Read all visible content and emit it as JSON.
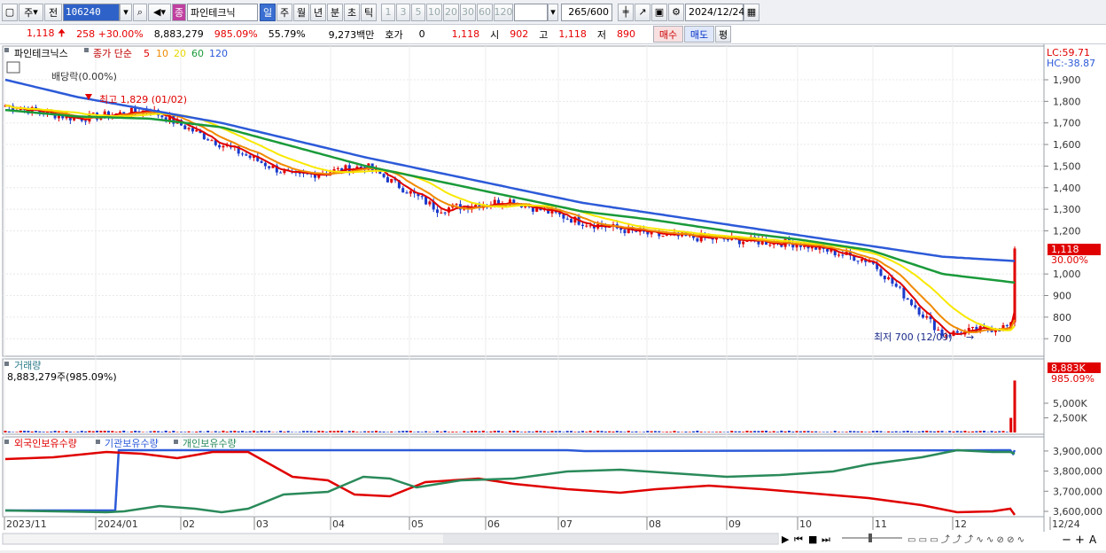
{
  "toolbar": {
    "period_unit": "주",
    "prev_label": "전",
    "stock_code": "106240",
    "stock_badge": "종",
    "stock_name": "파인테크닉",
    "periods": [
      "일",
      "주",
      "월",
      "년",
      "분",
      "초",
      "틱"
    ],
    "selected_period": "일",
    "minutes": [
      "1",
      "3",
      "5",
      "10",
      "20",
      "30",
      "60",
      "120"
    ],
    "count": "265",
    "count_total": "/600",
    "date": "2024/12/24"
  },
  "quote": {
    "price": "1,118",
    "change": "258 +30.00%",
    "volume": "8,883,279",
    "volume_ratio": "985.09%",
    "turnover": "55.79%",
    "amount": "9,273백만",
    "hoga_label": "호가",
    "hoga_value": "0",
    "hoga_price": "1,118",
    "open_label": "시",
    "open": "902",
    "high_label": "고",
    "high": "1,118",
    "low_label": "저",
    "low": "890",
    "buy_label": "매수",
    "sell_label": "매도",
    "avg_label": "평"
  },
  "price_panel": {
    "stock_name": "파인테크닉스",
    "ma_label": "종가 단순",
    "ma_periods": [
      "5",
      "10",
      "20",
      "60",
      "120"
    ],
    "ma_colors": [
      "#e00000",
      "#f08a00",
      "#f8e800",
      "#1a9a3a",
      "#2c5ad8"
    ],
    "lc": "LC:59.71",
    "hc": "HC:-38.87",
    "dividend": "배당락(0.00%)",
    "high_note": "최고 1,829 (01/02)",
    "low_note": "최저 700 (12/09)",
    "current_price": "1,118",
    "current_pct": "30.00%",
    "y_ticks": [
      "1,900",
      "1,800",
      "1,700",
      "1,600",
      "1,500",
      "1,400",
      "1,300",
      "1,200",
      "1,000",
      "900",
      "800",
      "700"
    ]
  },
  "volume_panel": {
    "title": "거래량",
    "value": "8,883,279주(985.09%)",
    "current": "8,883K",
    "pct": "985.09%",
    "y_ticks": [
      "5,000K",
      "2,500K"
    ]
  },
  "holdings_panel": {
    "legend": [
      "외국인보유수량",
      "기관보유수량",
      "개인보유수량"
    ],
    "colors": [
      "#e00000",
      "#2c5ad8",
      "#2a8a5a"
    ],
    "y_ticks": [
      "3,900,000",
      "3,800,000",
      "3,700,000",
      "3,600,000"
    ]
  },
  "x_axis": [
    "2023/11",
    "2024/01",
    "02",
    "03",
    "04",
    "05",
    "06",
    "07",
    "08",
    "09",
    "10",
    "11",
    "12",
    "12/24"
  ],
  "chart_data": {
    "type": "line",
    "title": "파인테크닉스",
    "ylim": [
      650,
      1950
    ],
    "x": [
      "2023/11",
      "12",
      "2024/01",
      "02",
      "03",
      "04",
      "05",
      "06",
      "07",
      "08",
      "09",
      "10",
      "11",
      "12",
      "12/24"
    ],
    "series": [
      {
        "name": "close",
        "values": [
          1780,
          1720,
          1760,
          1600,
          1450,
          1500,
          1300,
          1340,
          1240,
          1180,
          1160,
          1140,
          1060,
          720,
          1118
        ]
      },
      {
        "name": "120",
        "values": [
          1900,
          1820,
          1760,
          1700,
          1620,
          1540,
          1470,
          1400,
          1330,
          1280,
          1230,
          1180,
          1130,
          1080,
          1060
        ]
      },
      {
        "name": "60",
        "values": [
          1760,
          1730,
          1720,
          1680,
          1590,
          1500,
          1430,
          1360,
          1290,
          1250,
          1200,
          1160,
          1110,
          1000,
          960
        ]
      }
    ]
  }
}
